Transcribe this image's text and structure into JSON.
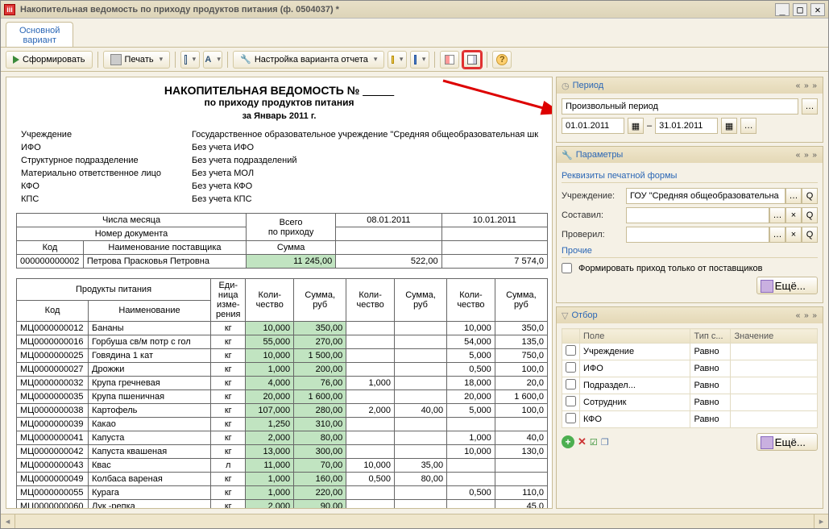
{
  "window": {
    "title": "Накопительная ведомость по приходу продуктов питания (ф. 0504037) *"
  },
  "tab": {
    "main": "Основной\nвариант"
  },
  "toolbar": {
    "generate": "Сформировать",
    "print": "Печать",
    "variant_settings": "Настройка варианта отчета"
  },
  "report": {
    "title_a": "НАКОПИТЕЛЬНАЯ ВЕДОМОСТЬ №",
    "title_b": "_____",
    "subtitle": "по приходу продуктов питания",
    "period_line": "за Январь 2011 г.",
    "info": [
      {
        "label": "Учреждение",
        "value": "Государственное образовательное учреждение \"Средняя общеобразовательная шк"
      },
      {
        "label": "ИФО",
        "value": "Без учета ИФО"
      },
      {
        "label": "Структурное подразделение",
        "value": "Без учета подразделений"
      },
      {
        "label": "Материально ответственное лицо",
        "value": "Без учета МОЛ"
      },
      {
        "label": "КФО",
        "value": "Без учета КФО"
      },
      {
        "label": "КПС",
        "value": "Без учета КПС"
      }
    ],
    "header1": {
      "month_days": "Числа месяца",
      "doc_number": "Номер документа",
      "code": "Код",
      "supplier_name": "Наименование поставщика",
      "total": "Всего\nпо приходу",
      "sum": "Сумма",
      "dates": [
        "08.01.2011",
        "10.01.2011"
      ]
    },
    "supplier_row": {
      "code": "000000000002",
      "name": "Петрова Прасковья Петровна",
      "total": "11 245,00",
      "c1": "522,00",
      "c2": "7 574,0"
    },
    "header2": {
      "products": "Продукты питания",
      "unit": "Еди-\nница\nизме-\nрения",
      "qty": "Коли-\nчество",
      "sum": "Сумма,\nруб",
      "code": "Код",
      "name": "Наименование"
    },
    "rows": [
      {
        "code": "МЦ0000000012",
        "name": "Бананы",
        "unit": "кг",
        "q0": "10,000",
        "s0": "350,00",
        "q1": "",
        "s1": "",
        "q2": "10,000",
        "s2": "350,0"
      },
      {
        "code": "МЦ0000000016",
        "name": "Горбуша св/м потр с гол",
        "unit": "кг",
        "q0": "55,000",
        "s0": "270,00",
        "q1": "",
        "s1": "",
        "q2": "54,000",
        "s2": "135,0"
      },
      {
        "code": "МЦ0000000025",
        "name": "Говядина 1 кат",
        "unit": "кг",
        "q0": "10,000",
        "s0": "1 500,00",
        "q1": "",
        "s1": "",
        "q2": "5,000",
        "s2": "750,0"
      },
      {
        "code": "МЦ0000000027",
        "name": "Дрожжи",
        "unit": "кг",
        "q0": "1,000",
        "s0": "200,00",
        "q1": "",
        "s1": "",
        "q2": "0,500",
        "s2": "100,0"
      },
      {
        "code": "МЦ0000000032",
        "name": "Крупа гречневая",
        "unit": "кг",
        "q0": "4,000",
        "s0": "76,00",
        "q1": "1,000",
        "s1": "",
        "q2": "18,000",
        "s2": "20,0"
      },
      {
        "code": "МЦ0000000035",
        "name": "Крупа пшеничная",
        "unit": "кг",
        "q0": "20,000",
        "s0": "1 600,00",
        "q1": "",
        "s1": "",
        "q2": "20,000",
        "s2": "1 600,0"
      },
      {
        "code": "МЦ0000000038",
        "name": "Картофель",
        "unit": "кг",
        "q0": "107,000",
        "s0": "280,00",
        "q1": "2,000",
        "s1": "40,00",
        "q2": "5,000",
        "s2": "100,0"
      },
      {
        "code": "МЦ0000000039",
        "name": "Какао",
        "unit": "кг",
        "q0": "1,250",
        "s0": "310,00",
        "q1": "",
        "s1": "",
        "q2": "",
        "s2": ""
      },
      {
        "code": "МЦ0000000041",
        "name": "Капуста",
        "unit": "кг",
        "q0": "2,000",
        "s0": "80,00",
        "q1": "",
        "s1": "",
        "q2": "1,000",
        "s2": "40,0"
      },
      {
        "code": "МЦ0000000042",
        "name": "Капуста квашеная",
        "unit": "кг",
        "q0": "13,000",
        "s0": "300,00",
        "q1": "",
        "s1": "",
        "q2": "10,000",
        "s2": "130,0"
      },
      {
        "code": "МЦ0000000043",
        "name": "Квас",
        "unit": "л",
        "q0": "11,000",
        "s0": "70,00",
        "q1": "10,000",
        "s1": "35,00",
        "q2": "",
        "s2": ""
      },
      {
        "code": "МЦ0000000049",
        "name": "Колбаса вареная",
        "unit": "кг",
        "q0": "1,000",
        "s0": "160,00",
        "q1": "0,500",
        "s1": "80,00",
        "q2": "",
        "s2": ""
      },
      {
        "code": "МЦ0000000055",
        "name": "Курага",
        "unit": "кг",
        "q0": "1,000",
        "s0": "220,00",
        "q1": "",
        "s1": "",
        "q2": "0,500",
        "s2": "110,0"
      },
      {
        "code": "МЦ0000000060",
        "name": "Лук -репка",
        "unit": "кг",
        "q0": "2,000",
        "s0": "90,00",
        "q1": "",
        "s1": "",
        "q2": "",
        "s2": "45,0"
      }
    ]
  },
  "side": {
    "period_hdr": "Период",
    "period_type": "Произвольный период",
    "date_from": "01.01.2011",
    "date_to": "31.01.2011",
    "params_hdr": "Параметры",
    "params_section": "Реквизиты печатной формы",
    "org_label": "Учреждение:",
    "org_value": "ГОУ \"Средняя общеобразовательна",
    "compiled_label": "Составил:",
    "checked_label": "Проверил:",
    "other_section": "Прочие",
    "chk_label": "Формировать приход только от поставщиков",
    "more_label": "Ещё...",
    "filter_hdr": "Отбор",
    "filter_cols": {
      "field": "Поле",
      "type": "Тип с...",
      "value": "Значение"
    },
    "filter_rows": [
      {
        "field": "Учреждение",
        "type": "Равно"
      },
      {
        "field": "ИФО",
        "type": "Равно"
      },
      {
        "field": "Подраздел...",
        "type": "Равно"
      },
      {
        "field": "Сотрудник",
        "type": "Равно"
      },
      {
        "field": "КФО",
        "type": "Равно"
      }
    ],
    "nav": "« »  »"
  }
}
